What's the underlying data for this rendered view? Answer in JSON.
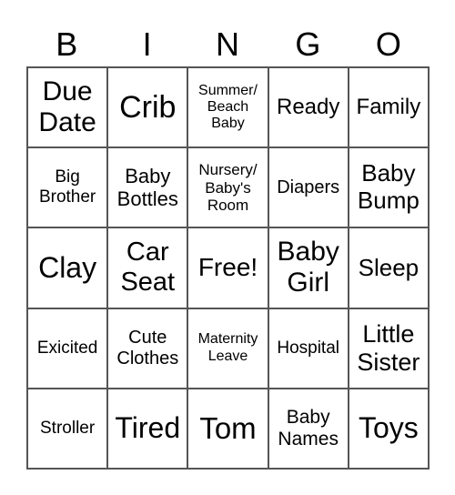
{
  "header": [
    "B",
    "I",
    "N",
    "G",
    "O"
  ],
  "cells": [
    "Due Date",
    "Crib",
    "Summer/ Beach Baby",
    "Ready",
    "Family",
    "Big Brother",
    "Baby Bottles",
    "Nursery/ Baby's Room",
    "Diapers",
    "Baby Bump",
    "Clay",
    "Car Seat",
    "Free!",
    "Baby Girl",
    "Sleep",
    "Exicited",
    "Cute Clothes",
    "Maternity Leave",
    "Hospital",
    "Little Sister",
    "Stroller",
    "Tired",
    "Tom",
    "Baby Names",
    "Toys"
  ]
}
